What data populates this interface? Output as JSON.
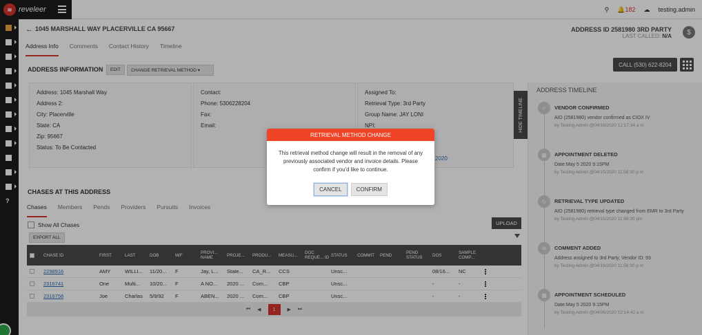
{
  "app": {
    "brand": "reveleer",
    "user": "testing.admin",
    "notification_count": "182"
  },
  "address": {
    "title": "1045 MARSHALL WAY PLACERVILLE CA 95667",
    "id_label": "ADDRESS ID 2581980",
    "party": "3RD PARTY",
    "last_called_label": "LAST CALLED:",
    "last_called_value": "N/A"
  },
  "tabs": [
    "Address Info",
    "Comments",
    "Contact History",
    "Timeline"
  ],
  "address_info": {
    "section_title": "ADDRESS INFORMATION",
    "edit_label": "EDIT",
    "change_method_label": "CHANGE RETRIEVAL METHOD",
    "call_label": "CALL (530) 622-8204",
    "left": [
      {
        "label": "Address:",
        "value": "1045 Marshall Way"
      },
      {
        "label": "Address 2:",
        "value": ""
      },
      {
        "label": "City:",
        "value": "Placerville"
      },
      {
        "label": "State:",
        "value": "CA"
      },
      {
        "label": "Zip:",
        "value": "95667"
      },
      {
        "label": "Status:",
        "value": "To Be Contacted"
      }
    ],
    "middle": [
      {
        "label": "Contact:",
        "value": ""
      },
      {
        "label": "Phone:",
        "value": "5306228204"
      },
      {
        "label": "Fax:",
        "value": ""
      },
      {
        "label": "Email:",
        "value": ""
      }
    ],
    "right": [
      {
        "label": "Assigned To:",
        "value": ""
      },
      {
        "label": "Retrieval Type:",
        "value": "3rd Party"
      },
      {
        "label": "Group Name:",
        "value": "JAY LONI"
      },
      {
        "label": "NPI:",
        "value": ""
      }
    ],
    "right_partial": "2020",
    "hide_timeline_label": "HIDE TIMELINE"
  },
  "timeline": {
    "title": "ADDRESS TIMELINE",
    "items": [
      {
        "icon": "check-icon",
        "head": "VENDOR CONFIRMED",
        "text": "AID (2581980) vendor confirmed as CIOX IV",
        "meta": "by Testing Admin @04/16/2020 12:17:34 a m"
      },
      {
        "icon": "calendar-icon",
        "head": "APPOINTMENT DELETED",
        "text": "Date:May 5 2020 9:15PM",
        "meta": "by Testing Admin @04/15/2020 11:56:30 p m"
      },
      {
        "icon": "refresh-icon",
        "head": "RETRIEVAL TYPE UPDATED",
        "text": "AID (2581980) retrieval type changed from EMR to 3rd Party",
        "meta": "by Testing Admin @04/15/2020 11:56:30 pm"
      },
      {
        "icon": "comment-icon",
        "head": "COMMENT ADDED",
        "text": "Address assigned to 3rd Party, Vendor ID: 93",
        "meta": "by Testing Admin @04/16/2020 11:56:30 p m"
      },
      {
        "icon": "calendar-icon",
        "head": "APPOINTMENT SCHEDULED",
        "text": "Date:May 5 2020 9:15PM",
        "meta": "by Testing Admin @04/06/2020 02:14:42 a m"
      }
    ]
  },
  "chases": {
    "section_title": "CHASES AT THIS ADDRESS",
    "tabs": [
      "Chases",
      "Members",
      "Pends",
      "Providers",
      "Pursuits",
      "Invoices"
    ],
    "show_all_label": "Show All Chases",
    "export_label": "EXPORT ALL",
    "upload_label": "UPLOAD",
    "columns": [
      "CHASE ID",
      "FIRST",
      "LAST",
      "DOB",
      "M/F",
      "PROVI... NAME",
      "PROJE...",
      "PRODU...",
      "MEASU...",
      "DOC REQUE... ID",
      "STATUS",
      "COMMIT",
      "PEND",
      "PEND STATUS",
      "DOS",
      "SAMPLE COMP..."
    ],
    "rows": [
      [
        "2298916",
        "AMY",
        "WILLI...",
        "11/20...",
        "F",
        "Jay, L...",
        "State...",
        "CA_R...",
        "CCS",
        "",
        "Unsc...",
        "",
        "",
        "",
        "08/16...",
        "NC"
      ],
      [
        "2316741",
        "One",
        "Multi...",
        "10/20...",
        "F",
        "A NO...",
        "2020 ...",
        "Com...",
        "CBP",
        "",
        "Unsc...",
        "",
        "",
        "",
        "-",
        "-"
      ],
      [
        "2316758",
        "Joe",
        "Charlas",
        "5/9/92",
        "F",
        "ABEN...",
        "2020 ...",
        "Com...",
        "CBP",
        "",
        "Unsc...",
        "",
        "",
        "",
        "-",
        "-"
      ]
    ],
    "page": "1"
  },
  "modal": {
    "title": "RETRIEVAL METHOD CHANGE",
    "message": "This retrieval method change will result in the removal of any previously associated vendor and invoice details. Please confirm if you'd like to continue.",
    "cancel_label": "CANCEL",
    "confirm_label": "CONFIRM"
  }
}
